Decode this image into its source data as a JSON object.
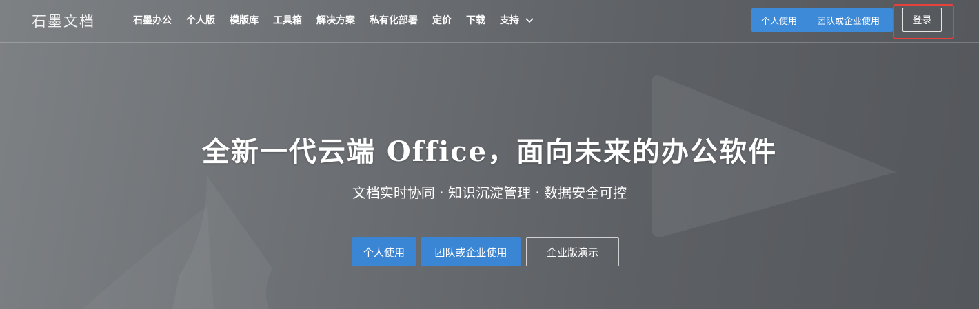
{
  "header": {
    "logo": "石墨文档",
    "nav": [
      {
        "label": "石墨办公"
      },
      {
        "label": "个人版"
      },
      {
        "label": "模版库"
      },
      {
        "label": "工具箱"
      },
      {
        "label": "解决方案"
      },
      {
        "label": "私有化部署"
      },
      {
        "label": "定价"
      },
      {
        "label": "下载"
      },
      {
        "label": "支持",
        "icon": "chevron-down-icon"
      }
    ],
    "cta": {
      "personal": "个人使用",
      "team": "团队或企业使用"
    },
    "login": "登录",
    "highlight_color": "#e8413c"
  },
  "hero": {
    "title": "全新一代云端 Office，面向未来的办公软件",
    "subtitle": "文档实时协同 · 知识沉淀管理 · 数据安全可控",
    "buttons": {
      "personal": "个人使用",
      "team": "团队或企业使用",
      "demo": "企业版演示"
    }
  },
  "colors": {
    "accent": "#3a86d4",
    "background": "#6c6f73"
  }
}
